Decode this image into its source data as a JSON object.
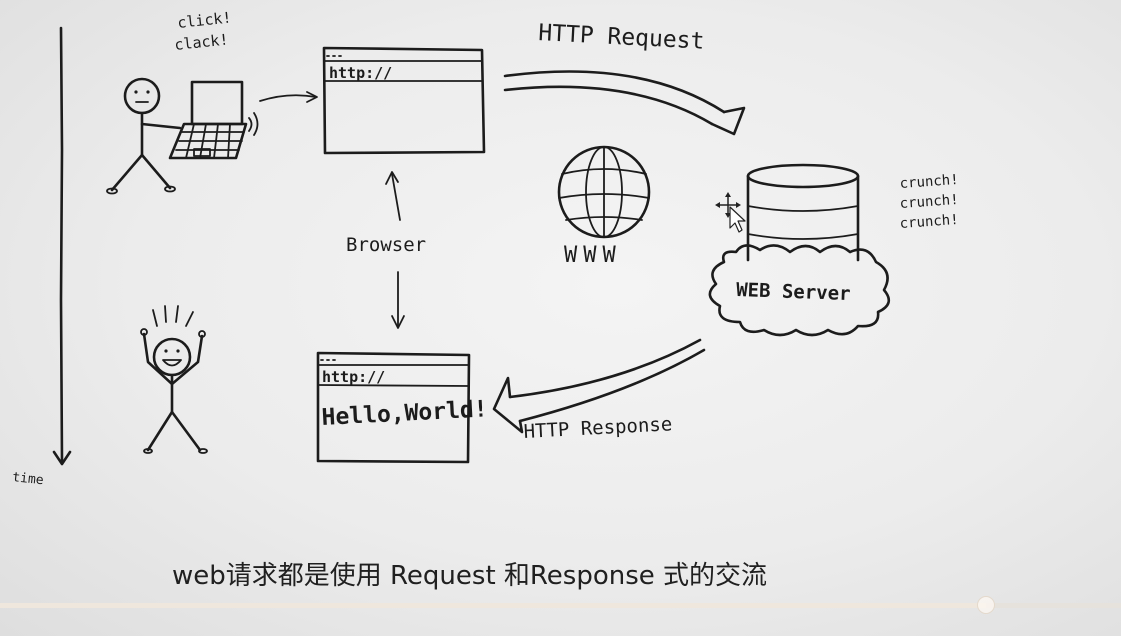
{
  "diagram": {
    "time_label": "time",
    "user_sound": [
      "click!",
      "clack!"
    ],
    "url_text": "http://",
    "request_label": "HTTP Request",
    "browser_label": "Browser",
    "www_label": "WWW",
    "server_sound": [
      "crunch!",
      "crunch!",
      "crunch!"
    ],
    "server_label": "WEB Server",
    "response_label": "HTTP Response",
    "response_page_text": "Hello,World!"
  },
  "caption": "web请求都是使用 Request 和Response 式的交流",
  "player": {
    "progress": 0.88
  }
}
